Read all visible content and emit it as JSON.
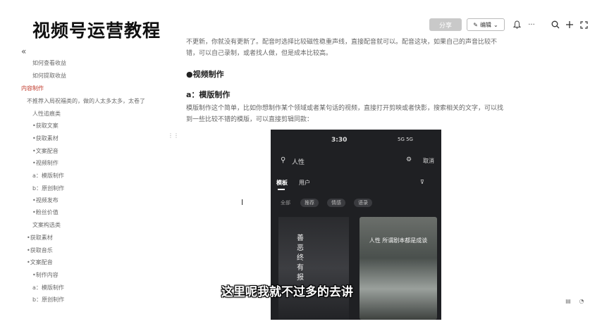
{
  "brand": "视频号运营教程",
  "toolbar": {
    "share_label": "分享",
    "edit_label": "编辑",
    "more_label": "···"
  },
  "sidebar": {
    "collapse_glyph": "«",
    "items": [
      {
        "label": "如何查看收益"
      },
      {
        "label": "如何提取收益"
      },
      {
        "label": "内容制作"
      },
      {
        "label": "不推荐入局祝福类的，做的人太多太多，太卷了"
      },
      {
        "label": "人性追痕类"
      },
      {
        "label": "•获取文案"
      },
      {
        "label": "•获取素材"
      },
      {
        "label": "•文案配音"
      },
      {
        "label": "•视频制作"
      },
      {
        "label": "a：模版制作"
      },
      {
        "label": "b：原创制作"
      },
      {
        "label": "•视频发布"
      },
      {
        "label": "•粉丝价值"
      },
      {
        "label": "文案构选类"
      },
      {
        "label": "•获取素材"
      },
      {
        "label": "•获取音乐"
      },
      {
        "label": "•文案配音"
      },
      {
        "label": "•制作内容"
      },
      {
        "label": "a：模版制作"
      },
      {
        "label": "b：原创制作"
      }
    ]
  },
  "content": {
    "para1_line1": "不更新，你就没有更新了。配音时选择比较磁性稳重声线，直接配音就可以。配音这块，如果自己的声音比较不",
    "para1_line2": "错，可以自己录制，或者找人做，但是成本比较高。",
    "heading_video": "●视频制作",
    "heading_template": "a：模版制作",
    "para2_line1": "模版制作这个简单，比如你想制作某个领域或者某句话的视频，直接打开剪映或者快影，搜索相关的文字，可以找",
    "para2_line2": "到一些比较不错的模版，可以直接剪辑同款："
  },
  "phone": {
    "time": "3:30",
    "status": "5G 5G",
    "search_text": "人性",
    "cancel": "取消",
    "tab_template": "模板",
    "tab_user": "用户",
    "filter_label": "全部",
    "chips": [
      "推荐",
      "情感",
      "语录"
    ],
    "thumb_left_text": "善 恶 终 有 报",
    "thumb_right_text": "人性 所谓剧本都是成谈"
  },
  "subtitle": "这里呢我就不过多的去讲"
}
